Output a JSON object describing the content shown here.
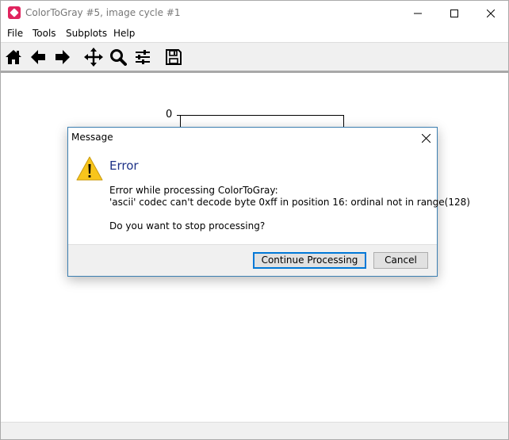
{
  "window": {
    "title": "ColorToGray #5, image cycle #1",
    "app_icon": "app-logo-icon",
    "controls": [
      "minimize-icon",
      "maximize-icon",
      "close-icon"
    ]
  },
  "menubar": {
    "items": [
      "File",
      "Tools",
      "Subplots",
      "Help"
    ]
  },
  "toolbar": {
    "tools": [
      "home-icon",
      "back-arrow-icon",
      "forward-arrow-icon",
      "pan-icon",
      "zoom-icon",
      "configure-subplots-icon",
      "save-icon"
    ]
  },
  "plot": {
    "y_tick_label": "0"
  },
  "dialog": {
    "title": "Message",
    "heading": "Error",
    "line1": "Error while processing ColorToGray:",
    "line2": "'ascii' codec can't decode byte 0xff in position 16: ordinal not in range(128)",
    "question": "Do you want to stop processing?",
    "continue_label": "Continue Processing",
    "cancel_label": "Cancel",
    "icon": "warning-icon"
  },
  "colors": {
    "accent": "#0078d7",
    "heading": "#1e3287",
    "warning": "#f8c51c",
    "app_icon": "#e0245e"
  }
}
